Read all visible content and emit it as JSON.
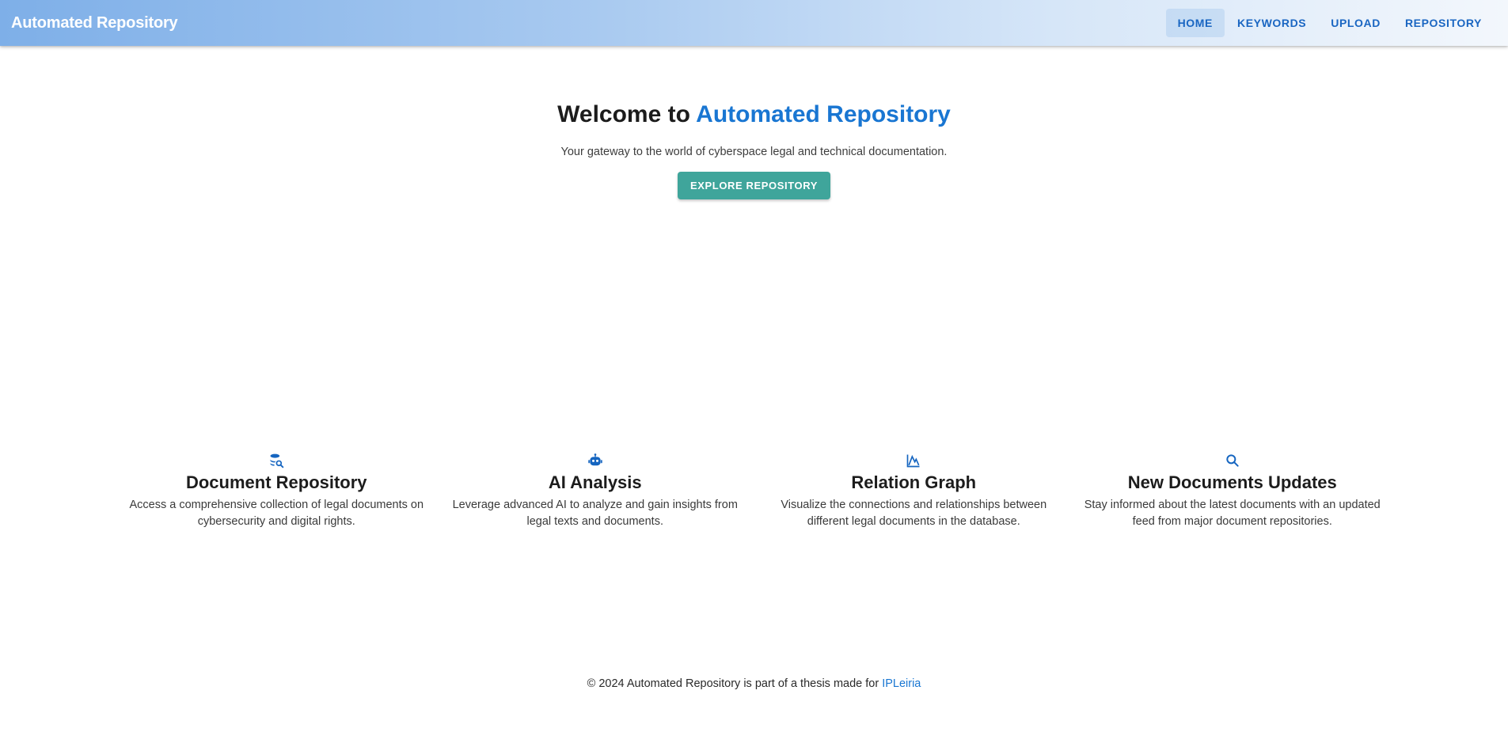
{
  "app": {
    "title": "Automated Repository"
  },
  "nav": {
    "items": [
      {
        "label": "HOME",
        "active": true
      },
      {
        "label": "KEYWORDS",
        "active": false
      },
      {
        "label": "UPLOAD",
        "active": false
      },
      {
        "label": "REPOSITORY",
        "active": false
      }
    ]
  },
  "hero": {
    "title_prefix": "Welcome to ",
    "title_accent": "Automated Repository",
    "subtitle": "Your gateway to the world of cyberspace legal and technical documentation.",
    "cta_label": "EXPLORE REPOSITORY"
  },
  "features": [
    {
      "icon": "database-search-icon",
      "title": "Document Repository",
      "text_line1": "Access a comprehensive collection of legal documents on",
      "text_line2": "cybersecurity and digital rights."
    },
    {
      "icon": "robot-icon",
      "title": "AI Analysis",
      "text_line1": "Leverage advanced AI to analyze and gain insights from",
      "text_line2": "legal texts and documents."
    },
    {
      "icon": "chart-line-icon",
      "title": "Relation Graph",
      "text_line1": "Visualize the connections and relationships between",
      "text_line2": "different legal documents in the database."
    },
    {
      "icon": "search-icon",
      "title": "New Documents Updates",
      "text_line1": "Stay informed about the latest documents with an updated",
      "text_line2": "feed from major document repositories."
    }
  ],
  "footer": {
    "text": "© 2024 Automated Repository is part of a thesis made for ",
    "link_label": "IPLeiria"
  },
  "colors": {
    "accent": "#1976d2",
    "cta": "#3fa59b",
    "appbar_start": "#7eafe8",
    "appbar_end": "#f3f7fc"
  }
}
